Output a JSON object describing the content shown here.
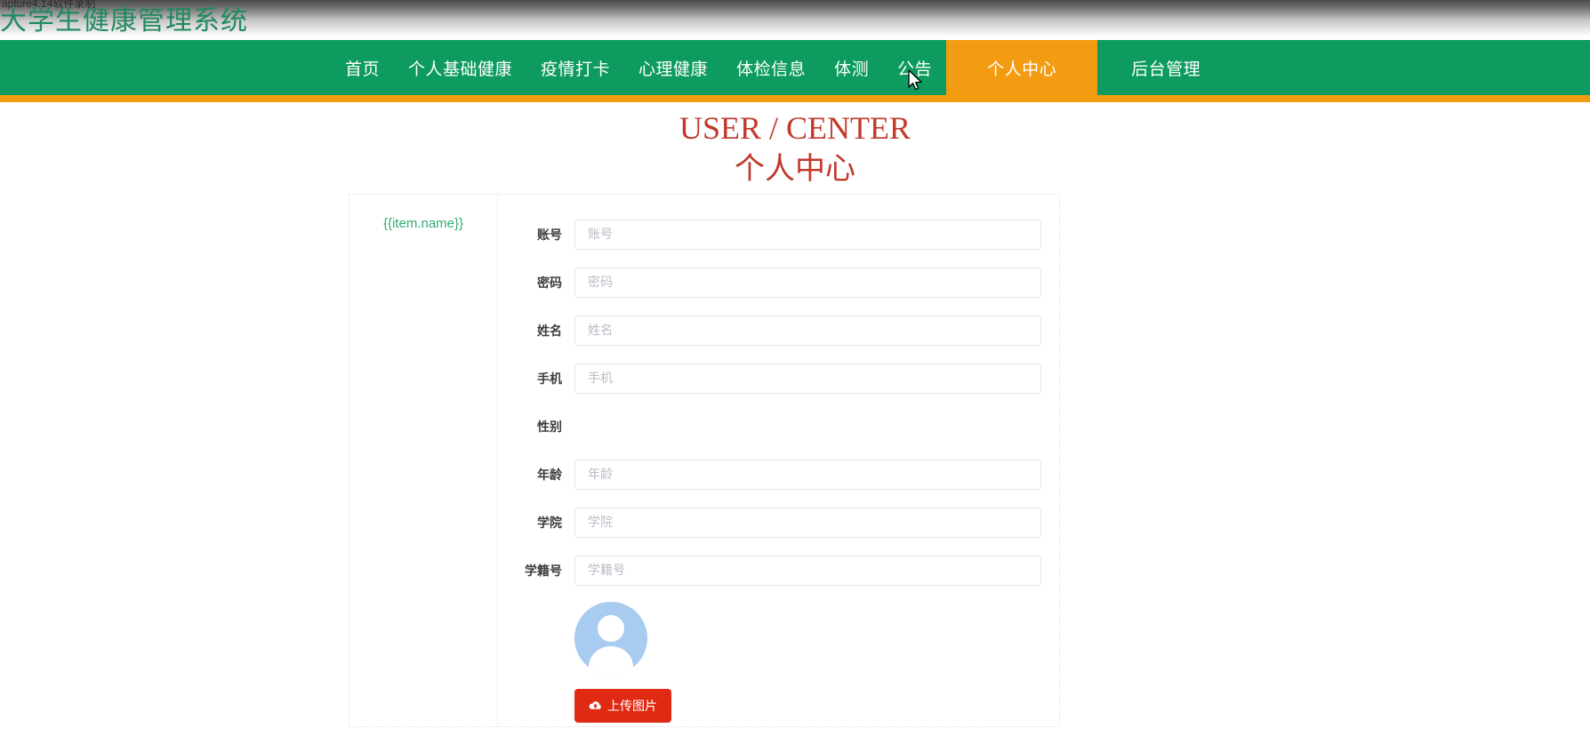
{
  "banner": {
    "site_title": "大学生健康管理系统",
    "capture_watermark": "apture4.14软件录制"
  },
  "nav": {
    "items": [
      {
        "label": "首页",
        "active": false
      },
      {
        "label": "个人基础健康",
        "active": false
      },
      {
        "label": "疫情打卡",
        "active": false
      },
      {
        "label": "心理健康",
        "active": false
      },
      {
        "label": "体检信息",
        "active": false
      },
      {
        "label": "体测",
        "active": false
      },
      {
        "label": "公告",
        "active": false
      },
      {
        "label": "个人中心",
        "active": true
      },
      {
        "label": "后台管理",
        "active": false
      }
    ],
    "bar_color": "#0d9b5f",
    "active_color": "#f39c12"
  },
  "page": {
    "title_en": "USER / CENTER",
    "title_cn": "个人中心",
    "title_color": "#c0392b"
  },
  "card": {
    "left_panel_text": "{{item.name}}",
    "left_panel_color": "#2eac72"
  },
  "form": {
    "fields": [
      {
        "label": "账号",
        "placeholder": "账号",
        "value": "",
        "type": "input"
      },
      {
        "label": "密码",
        "placeholder": "密码",
        "value": "",
        "type": "input"
      },
      {
        "label": "姓名",
        "placeholder": "姓名",
        "value": "",
        "type": "input"
      },
      {
        "label": "手机",
        "placeholder": "手机",
        "value": "",
        "type": "input"
      },
      {
        "label": "性别",
        "placeholder": "",
        "value": "",
        "type": "radio"
      },
      {
        "label": "年龄",
        "placeholder": "年龄",
        "value": "",
        "type": "input"
      },
      {
        "label": "学院",
        "placeholder": "学院",
        "value": "",
        "type": "input"
      },
      {
        "label": "学籍号",
        "placeholder": "学籍号",
        "value": "",
        "type": "input"
      }
    ],
    "avatar_alt": "默认头像",
    "upload_button_label": "上传图片",
    "upload_button_color": "#e02a14"
  }
}
